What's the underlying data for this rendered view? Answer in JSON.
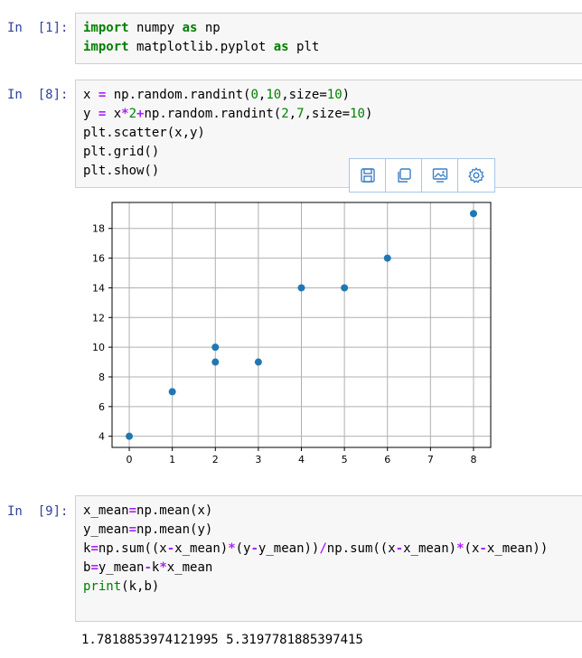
{
  "cells": [
    {
      "prompt": "In  [1]:",
      "lines": [
        [
          {
            "t": "import",
            "c": "kw"
          },
          {
            "t": " numpy ",
            "c": ""
          },
          {
            "t": "as",
            "c": "kw"
          },
          {
            "t": " np",
            "c": ""
          }
        ],
        [
          {
            "t": "import",
            "c": "kw"
          },
          {
            "t": " matplotlib.pyplot ",
            "c": ""
          },
          {
            "t": "as",
            "c": "kw"
          },
          {
            "t": " plt",
            "c": ""
          }
        ]
      ]
    },
    {
      "prompt": "In  [8]:",
      "lines": [
        [
          {
            "t": "x ",
            "c": ""
          },
          {
            "t": "=",
            "c": "op"
          },
          {
            "t": " np.random.randint(",
            "c": ""
          },
          {
            "t": "0",
            "c": "num"
          },
          {
            "t": ",",
            "c": ""
          },
          {
            "t": "10",
            "c": "num"
          },
          {
            "t": ",size=",
            "c": ""
          },
          {
            "t": "10",
            "c": "num"
          },
          {
            "t": ")",
            "c": ""
          }
        ],
        [
          {
            "t": "y ",
            "c": ""
          },
          {
            "t": "=",
            "c": "op"
          },
          {
            "t": " x",
            "c": ""
          },
          {
            "t": "*",
            "c": "op"
          },
          {
            "t": "2",
            "c": "num"
          },
          {
            "t": "+",
            "c": "op"
          },
          {
            "t": "np.random.randint(",
            "c": ""
          },
          {
            "t": "2",
            "c": "num"
          },
          {
            "t": ",",
            "c": ""
          },
          {
            "t": "7",
            "c": "num"
          },
          {
            "t": ",size=",
            "c": ""
          },
          {
            "t": "10",
            "c": "num"
          },
          {
            "t": ")",
            "c": ""
          }
        ],
        [
          {
            "t": "plt.scatter(x,y)",
            "c": ""
          }
        ],
        [
          {
            "t": "plt.grid()",
            "c": ""
          }
        ],
        [
          {
            "t": "plt.show()",
            "c": ""
          }
        ]
      ]
    },
    {
      "prompt": "In  [9]:",
      "lines": [
        [
          {
            "t": "x_mean",
            "c": ""
          },
          {
            "t": "=",
            "c": "op"
          },
          {
            "t": "np.mean(x)",
            "c": ""
          }
        ],
        [
          {
            "t": "y_mean",
            "c": ""
          },
          {
            "t": "=",
            "c": "op"
          },
          {
            "t": "np.mean(y)",
            "c": ""
          }
        ],
        [
          {
            "t": "k",
            "c": ""
          },
          {
            "t": "=",
            "c": "op"
          },
          {
            "t": "np.sum((x",
            "c": ""
          },
          {
            "t": "-",
            "c": "op"
          },
          {
            "t": "x_mean)",
            "c": ""
          },
          {
            "t": "*",
            "c": "op"
          },
          {
            "t": "(y",
            "c": ""
          },
          {
            "t": "-",
            "c": "op"
          },
          {
            "t": "y_mean))",
            "c": ""
          },
          {
            "t": "/",
            "c": "op"
          },
          {
            "t": "np.sum((x",
            "c": ""
          },
          {
            "t": "-",
            "c": "op"
          },
          {
            "t": "x_mean)",
            "c": ""
          },
          {
            "t": "*",
            "c": "op"
          },
          {
            "t": "(x",
            "c": ""
          },
          {
            "t": "-",
            "c": "op"
          },
          {
            "t": "x_mean))",
            "c": ""
          }
        ],
        [
          {
            "t": "b",
            "c": ""
          },
          {
            "t": "=",
            "c": "op"
          },
          {
            "t": "y_mean",
            "c": ""
          },
          {
            "t": "-",
            "c": "op"
          },
          {
            "t": "k",
            "c": ""
          },
          {
            "t": "*",
            "c": "op"
          },
          {
            "t": "x_mean",
            "c": ""
          }
        ],
        [
          {
            "t": "print",
            "c": "fn"
          },
          {
            "t": "(k,b)",
            "c": ""
          }
        ]
      ]
    }
  ],
  "toolbar": {
    "buttons": [
      {
        "icon": "save-icon"
      },
      {
        "icon": "copy-icon"
      },
      {
        "icon": "image-icon"
      },
      {
        "icon": "settings-icon"
      }
    ],
    "color": "#3b7fc4"
  },
  "output_text": "1.7818853974121995 5.3197781885397415",
  "chart_data": {
    "type": "scatter",
    "x": [
      0,
      1,
      2,
      2,
      3,
      4,
      5,
      6,
      8
    ],
    "y": [
      4,
      7,
      9,
      10,
      9,
      14,
      14,
      16,
      19
    ],
    "xlim": [
      -0.4,
      8.4
    ],
    "ylim": [
      3.25,
      19.75
    ],
    "xticks": [
      0,
      1,
      2,
      3,
      4,
      5,
      6,
      7,
      8
    ],
    "yticks": [
      4,
      6,
      8,
      10,
      12,
      14,
      16,
      18
    ],
    "grid": true,
    "marker_color": "#1f77b4"
  }
}
